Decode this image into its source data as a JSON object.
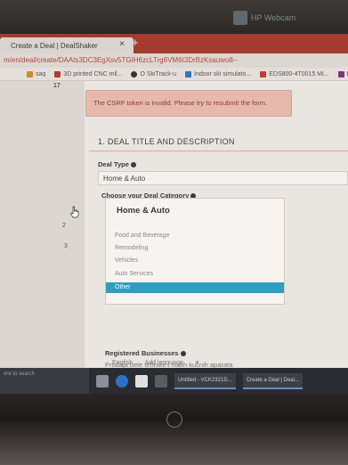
{
  "monitor": {
    "brand_text": "HP Webcam"
  },
  "browser": {
    "tab_title": "Create a Deal | DealShaker",
    "tab_close": "×",
    "new_tab": "+",
    "url": "m/en/deal/create/DAAts3DC3EgXsv5TGIH6zcLTrg6VM6t3DrBzKsauwo8–",
    "bookmarks": [
      "saq",
      "3D printed CNC mil...",
      "O SkiTrack-u",
      "Indoor ski simulato...",
      "EDS800-4T0015 Mi...",
      "Da"
    ]
  },
  "page": {
    "left_steps": [
      "17",
      "2",
      "3"
    ],
    "alert": "The CSRF token is invalid. Please try to resubmit the form.",
    "section_title": "1. DEAL TITLE AND DESCRIPTION",
    "deal_type_label": "Deal Type",
    "deal_type_value": "Home & Auto",
    "category_label": "Choose your Deal Category",
    "dropdown": {
      "header": "Home & Auto",
      "options": [
        "Food and Beverage",
        "Remodeling",
        "Vehicles",
        "Auto Services",
        "Other"
      ],
      "selected_index": 4
    },
    "businesses_label": "Registered Businesses",
    "businesses_value": "Prodaja bele tehnike i malih kucnih aparata",
    "lang_current": "English",
    "lang_add": "Add language",
    "lang_add_caret": "▾"
  },
  "taskbar": {
    "search_text": "ere to search",
    "apps": [
      "Untitled - VCK2321D...",
      "Create a Deal | Deal..."
    ]
  },
  "colors": {
    "tabbar": "#a43c2e",
    "selected_option": "#2f9ec0",
    "alert_bg": "#e7b9ae",
    "alert_text": "#8a3a30"
  }
}
